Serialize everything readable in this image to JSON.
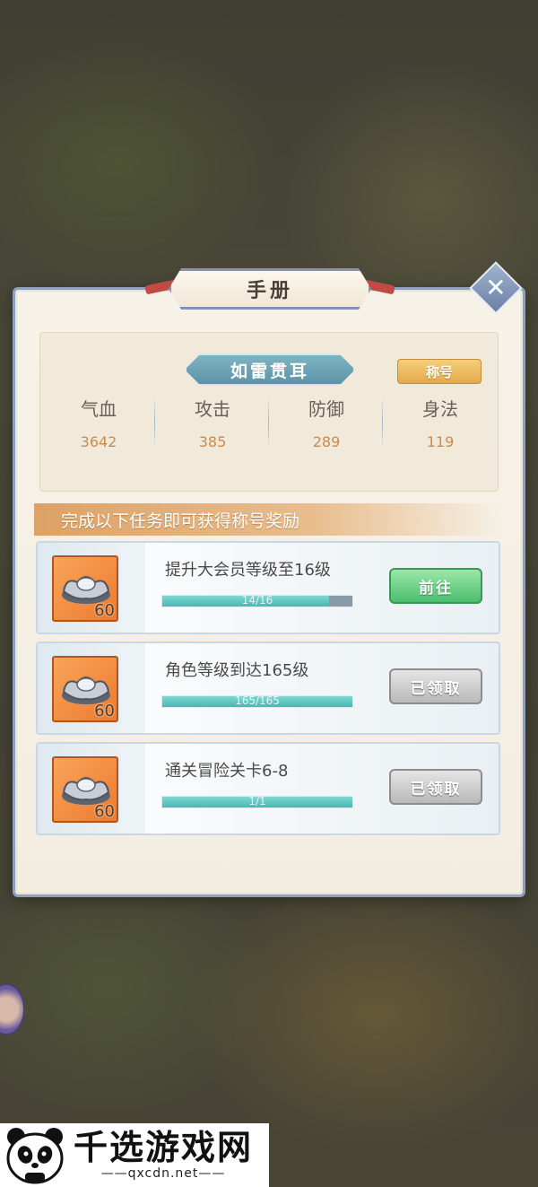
{
  "modal": {
    "title": "手册",
    "close_glyph": "✕"
  },
  "title_info": {
    "title_name": "如雷贯耳",
    "badge_label": "称号",
    "stats": [
      {
        "label": "气血",
        "value": "3642"
      },
      {
        "label": "攻击",
        "value": "385"
      },
      {
        "label": "防御",
        "value": "289"
      },
      {
        "label": "身法",
        "value": "119"
      }
    ]
  },
  "tasks": {
    "header": "完成以下任务即可获得称号奖励",
    "items": [
      {
        "name": "提升大会员等级至16级",
        "progress_text": "14/16",
        "progress": 0.875,
        "reward_count": "60",
        "reward_icon": "silver-ingot-icon",
        "button": "前往",
        "button_state": "go"
      },
      {
        "name": "角色等级到达165级",
        "progress_text": "165/165",
        "progress": 1.0,
        "reward_count": "60",
        "reward_icon": "silver-ingot-icon",
        "button": "已领取",
        "button_state": "claimed"
      },
      {
        "name": "通关冒险关卡6-8",
        "progress_text": "1/1",
        "progress": 1.0,
        "reward_count": "60",
        "reward_icon": "silver-ingot-icon",
        "button": "已领取",
        "button_state": "claimed"
      }
    ]
  },
  "watermark": {
    "brand": "千选游戏网",
    "url": "——qxcdn.net——"
  },
  "colors": {
    "accent_orange": "#cc8c4e",
    "progress_teal": "#48b8b0",
    "go_green": "#4bbf6e",
    "frame_blue": "#8ea0c0"
  }
}
